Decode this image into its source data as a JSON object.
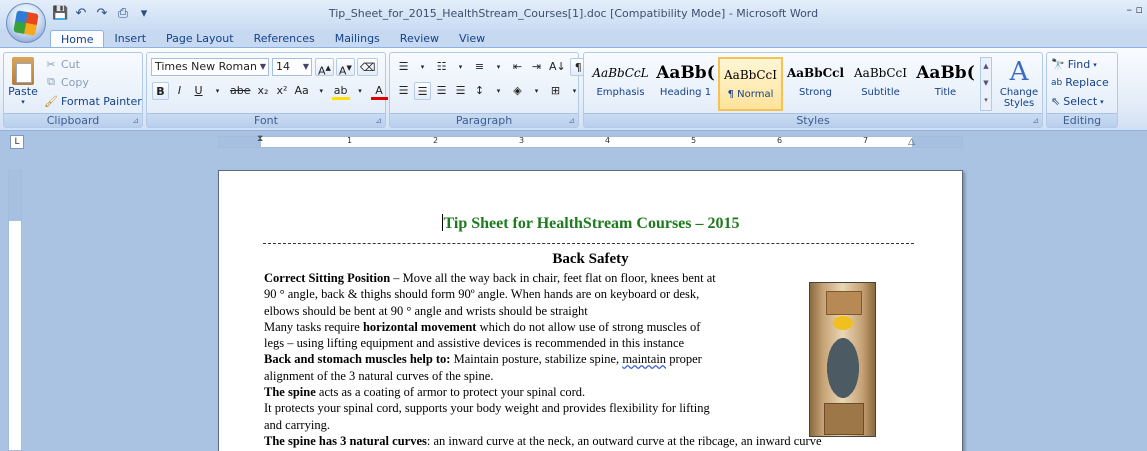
{
  "window": {
    "title": "Tip_Sheet_for_2015_HealthStream_Courses[1].doc [Compatibility Mode] - Microsoft Word",
    "controls": "– ▫"
  },
  "quick_access": [
    "save-icon",
    "undo-icon",
    "redo-icon",
    "print-preview-icon"
  ],
  "tabs": [
    {
      "label": "Home",
      "active": true
    },
    {
      "label": "Insert"
    },
    {
      "label": "Page Layout"
    },
    {
      "label": "References"
    },
    {
      "label": "Mailings"
    },
    {
      "label": "Review"
    },
    {
      "label": "View"
    }
  ],
  "ribbon": {
    "clipboard": {
      "label": "Clipboard",
      "paste": "Paste",
      "cut": "Cut",
      "copy": "Copy",
      "format_painter": "Format Painter"
    },
    "font": {
      "label": "Font",
      "font_name": "Times New Roman",
      "font_size": "14",
      "grow": "A",
      "shrink": "A",
      "bold": "B",
      "italic": "I",
      "underline": "U",
      "strike": "abe",
      "subscript": "x₂",
      "superscript": "x²",
      "change_case": "Aa",
      "highlight": "ab",
      "font_color": "A"
    },
    "paragraph": {
      "label": "Paragraph",
      "show_marks": "¶",
      "sort": "A↓"
    },
    "styles": {
      "label": "Styles",
      "items": [
        {
          "sample": "AaBbCcL",
          "name": "Emphasis"
        },
        {
          "sample": "AaBb(",
          "name": "Heading 1"
        },
        {
          "sample": "AaBbCcI",
          "name": "¶ Normal",
          "selected": true
        },
        {
          "sample": "AaBbCcl",
          "name": "Strong"
        },
        {
          "sample": "AaBbCcI",
          "name": "Subtitle"
        },
        {
          "sample": "AaBb(",
          "name": "Title"
        }
      ],
      "change_styles": "Change Styles"
    },
    "editing": {
      "label": "Editing",
      "find": "Find",
      "replace": "Replace",
      "select": "Select"
    }
  },
  "ruler": {
    "numbers": [
      "1",
      "2",
      "3",
      "4",
      "5",
      "6",
      "7"
    ]
  },
  "document": {
    "title": "Tip Sheet for HealthStream Courses – 2015",
    "section_heading": "Back Safety",
    "lines": [
      {
        "bold": "Correct Sitting Position",
        "text": " – Move all the way back in chair, feet flat on floor, knees bent at"
      },
      {
        "bold": "",
        "text": "90 ° angle, back & thighs should form 90º angle.  When hands are on keyboard or desk,"
      },
      {
        "bold": "",
        "text": "elbows should be bent at 90 ° angle and wrists should be straight"
      },
      {
        "bold": "",
        "text": "Many tasks require "
      },
      {
        "bold": "",
        "text": "legs – using lifting equipment and assistive  devices is recommended in this instance"
      },
      {
        "bold": "Back and stomach muscles help to:",
        "text": "  Maintain posture, stabilize spine, "
      },
      {
        "bold": "",
        "text": "alignment of the 3 natural curves of the spine."
      },
      {
        "bold": "The spine",
        "text": " acts as a coating of armor to protect your spinal cord."
      },
      {
        "bold": "",
        "text": "It protects your spinal cord, supports your body weight and provides flexibility for lifting"
      },
      {
        "bold": "",
        "text": "and carrying."
      },
      {
        "bold": "The spine has 3 natural curves",
        "text": ":  an inward curve at the neck, an outward curve at the ribcage, an inward curve"
      }
    ],
    "line4_bold": "horizontal movement",
    "line4_rest": " which do not allow use of strong muscles  of",
    "line6_wavy": "maintain",
    "line6_rest": " proper"
  }
}
